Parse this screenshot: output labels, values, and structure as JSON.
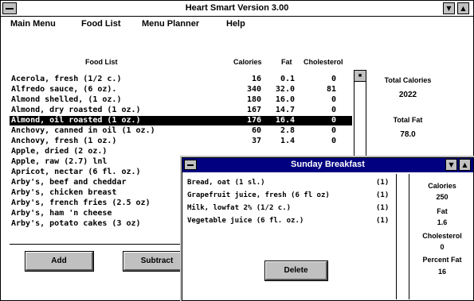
{
  "app": {
    "title": "Heart Smart Version 3.00",
    "minimize_glyph": "▼",
    "maximize_glyph": "▲"
  },
  "menu": [
    "Main Menu",
    "Food List",
    "Menu Planner",
    "Help"
  ],
  "food_list": {
    "headers": {
      "name": "Food List",
      "calories": "Calories",
      "fat": "Fat",
      "cholesterol": "Cholesterol"
    },
    "rows": [
      {
        "name": "Acerola, fresh (1/2 c.)",
        "calories": "16",
        "fat": "0.1",
        "chol": "0"
      },
      {
        "name": "Alfredo sauce, (6 oz).",
        "calories": "340",
        "fat": "32.0",
        "chol": "81"
      },
      {
        "name": "Almond shelled, (1 oz.)",
        "calories": "180",
        "fat": "16.0",
        "chol": "0"
      },
      {
        "name": "Almond, dry roasted (1 oz.)",
        "calories": "167",
        "fat": "14.7",
        "chol": "0"
      },
      {
        "name": "Almond, oil roasted (1 oz.)",
        "calories": "176",
        "fat": "16.4",
        "chol": "0"
      },
      {
        "name": "Anchovy, canned in oil (1 oz.)",
        "calories": "60",
        "fat": "2.8",
        "chol": "0"
      },
      {
        "name": "Anchovy, fresh (1 oz.)",
        "calories": "37",
        "fat": "1.4",
        "chol": "0"
      },
      {
        "name": "Apple, dried (2 oz.)",
        "calories": "",
        "fat": "",
        "chol": ""
      },
      {
        "name": "Apple, raw (2.7) lnl",
        "calories": "",
        "fat": "",
        "chol": ""
      },
      {
        "name": "Apricot, nectar (6 fl. oz.)",
        "calories": "",
        "fat": "",
        "chol": ""
      },
      {
        "name": "Arby's, beef and cheddar",
        "calories": "",
        "fat": "",
        "chol": ""
      },
      {
        "name": "Arby's, chicken breast",
        "calories": "",
        "fat": "",
        "chol": ""
      },
      {
        "name": "Arby's, french fries (2.5 oz)",
        "calories": "",
        "fat": "",
        "chol": ""
      },
      {
        "name": "Arby's, ham 'n cheese",
        "calories": "",
        "fat": "",
        "chol": ""
      },
      {
        "name": "Arby's, potato cakes (3 oz)",
        "calories": "",
        "fat": "",
        "chol": ""
      }
    ],
    "selected_index": 4
  },
  "totals": {
    "calories_label": "Total Calories",
    "calories_value": "2022",
    "fat_label": "Total Fat",
    "fat_value": "78.0"
  },
  "buttons": {
    "add": "Add",
    "subtract": "Subtract",
    "delete": "Delete"
  },
  "child_window": {
    "title": "Sunday Breakfast",
    "items": [
      {
        "name": "Bread, oat (1 sl.)",
        "qty": "(1)"
      },
      {
        "name": "Grapefruit juice, fresh (6 fl oz)",
        "qty": "(1)"
      },
      {
        "name": "Milk, lowfat 2% (1/2 c.)",
        "qty": "(1)"
      },
      {
        "name": "Vegetable juice (6 fl. oz.)",
        "qty": "(1)"
      }
    ],
    "stats": {
      "calories_label": "Calories",
      "calories_value": "250",
      "fat_label": "Fat",
      "fat_value": "1.6",
      "cholesterol_label": "Cholesterol",
      "cholesterol_value": "0",
      "percent_fat_label": "Percent Fat",
      "percent_fat_value": "16"
    }
  }
}
